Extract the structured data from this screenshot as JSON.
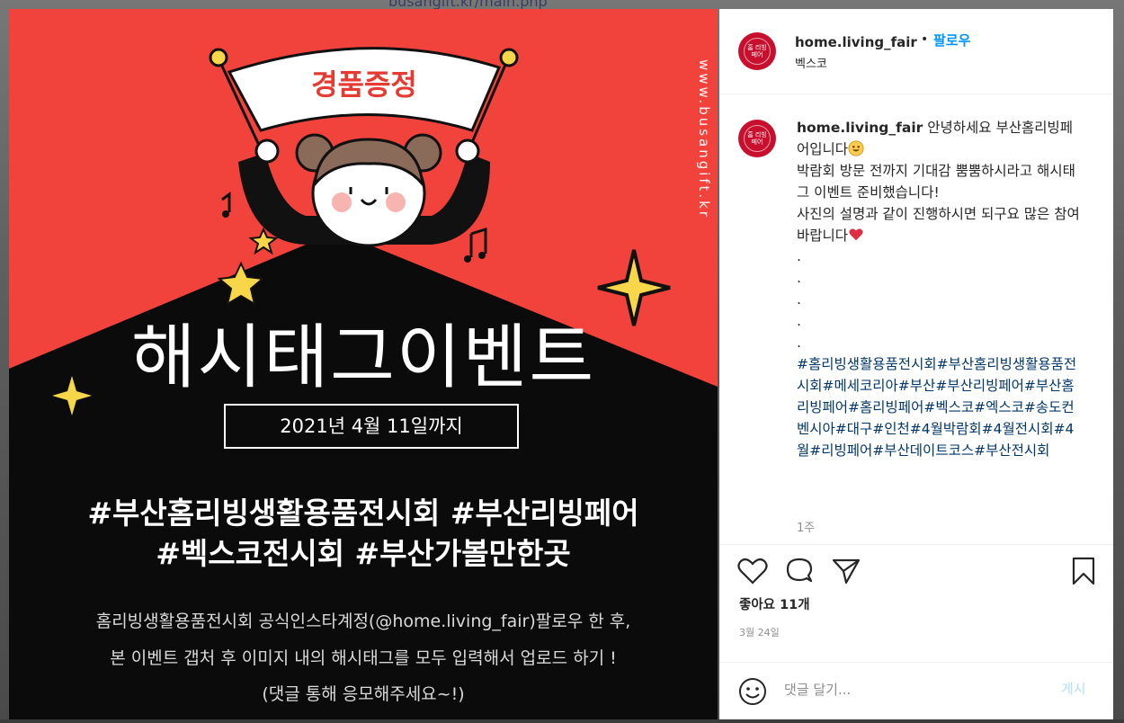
{
  "background": {
    "url_text": "busangift.kr/main.php"
  },
  "post_image": {
    "banner_text": "경품증정",
    "side_url": "www.busangift.kr",
    "event_title": "해시태그이벤트",
    "date_box": "2021년 4월 11일까지",
    "tags_line1": "#부산홈리빙생활용품전시회  #부산리빙페어",
    "tags_line2": "#벡스코전시회  #부산가볼만한곳",
    "desc_line1": "홈리빙생활용품전시회 공식인스타계정(@home.living_fair)팔로우 한 후,",
    "desc_line2": "본 이벤트 갭처 후 이미지 내의 해시태그를 모두 입력해서 업로드 하기 !",
    "desc_line3": "(댓글 통해 응모해주세요~!)",
    "colors": {
      "red": "#f1433b",
      "black": "#0b0b0b"
    }
  },
  "header": {
    "avatar_text": "홈 리빙 페어",
    "username": "home.living_fair",
    "separator": "•",
    "follow_label": "팔로우",
    "location": "벡스코"
  },
  "caption": {
    "username": "home.living_fair",
    "line1": " 안녕하세요 부산홈리빙페어입니다",
    "line2": "박람회 방문 전까지 기대감 뿜뿜하시라고 해시태그 이벤트 준비했습니다!",
    "line3": "사진의 설명과 같이 진행하시면 되구요 많은 참여 바랍니다",
    "dots": [
      ".",
      ".",
      ".",
      ".",
      "."
    ],
    "hashtags": "#홈리빙생활용품전시회#부산홈리빙생활용품전시회#메세코리아#부산#부산리빙페어#부산홈리빙페어#홈리빙페어#벡스코#엑스코#송도컨벤시아#대구#인천#4월박람회#4월전시회#4월#리빙페어#부산데이트코스#부산전시회",
    "time_ago": "1주"
  },
  "actions": {
    "like_label": "좋아요 11개",
    "date": "3월 24일"
  },
  "comment": {
    "placeholder": "댓글 달기...",
    "post_label": "게시"
  }
}
